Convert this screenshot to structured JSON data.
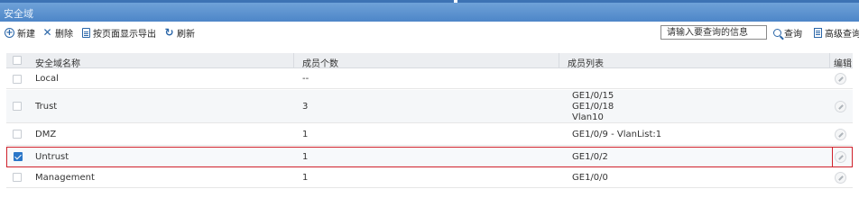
{
  "window": {
    "title": "安全域"
  },
  "toolbar": {
    "new_label": "新建",
    "delete_label": "删除",
    "export_label": "按页面显示导出",
    "refresh_label": "刷新",
    "search_placeholder": "请输入要查询的信息",
    "search_label": "查询",
    "advanced_label": "高级查询"
  },
  "table": {
    "headers": {
      "name": "安全域名称",
      "count": "成员个数",
      "members": "成员列表",
      "edit": "编辑"
    },
    "rows": [
      {
        "name": "Local",
        "count": "--",
        "members": [],
        "checked": false
      },
      {
        "name": "Trust",
        "count": "3",
        "members": [
          "GE1/0/15",
          "GE1/0/18",
          "Vlan10"
        ],
        "checked": false
      },
      {
        "name": "DMZ",
        "count": "1",
        "members": [
          "GE1/0/9 - VlanList:1"
        ],
        "checked": false
      },
      {
        "name": "Untrust",
        "count": "1",
        "members": [
          "GE1/0/2"
        ],
        "checked": true
      },
      {
        "name": "Management",
        "count": "1",
        "members": [
          "GE1/0/0"
        ],
        "checked": false
      }
    ]
  },
  "colors": {
    "title_bar": "#4d86c8",
    "accent": "#2a66a8",
    "selection_border": "#d0212b"
  }
}
